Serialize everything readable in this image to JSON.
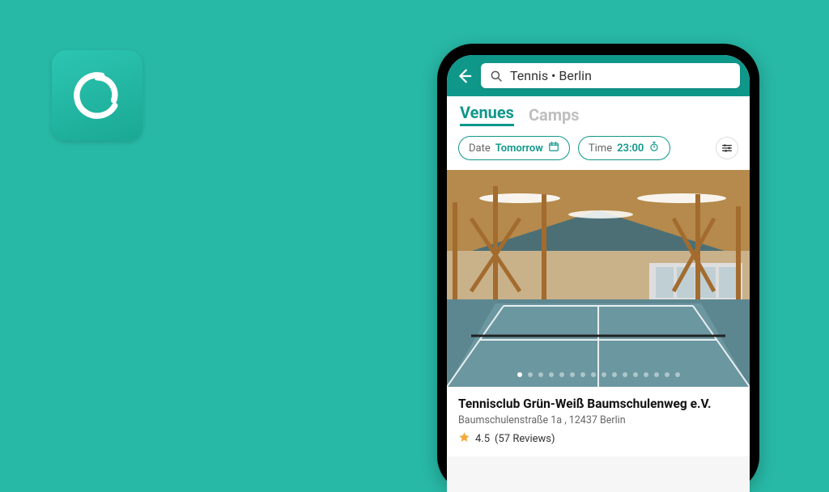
{
  "brand": {
    "accent": "#0f978a",
    "bg": "#28b8a6"
  },
  "search": {
    "query": "Tennis • Berlin"
  },
  "tabs": {
    "venues": "Venues",
    "camps": "Camps",
    "active": "venues"
  },
  "filters": {
    "date_label": "Date",
    "date_value": "Tomorrow",
    "time_label": "Time",
    "time_value": "23:00"
  },
  "carousel": {
    "count": 16,
    "active": 0
  },
  "venue": {
    "name": "Tennisclub Grün-Weiß Baumschulenweg e.V.",
    "address": "Baumschulenstraße 1a , 12437 Berlin",
    "rating_value": "4.5",
    "reviews_text": "(57 Reviews)"
  }
}
